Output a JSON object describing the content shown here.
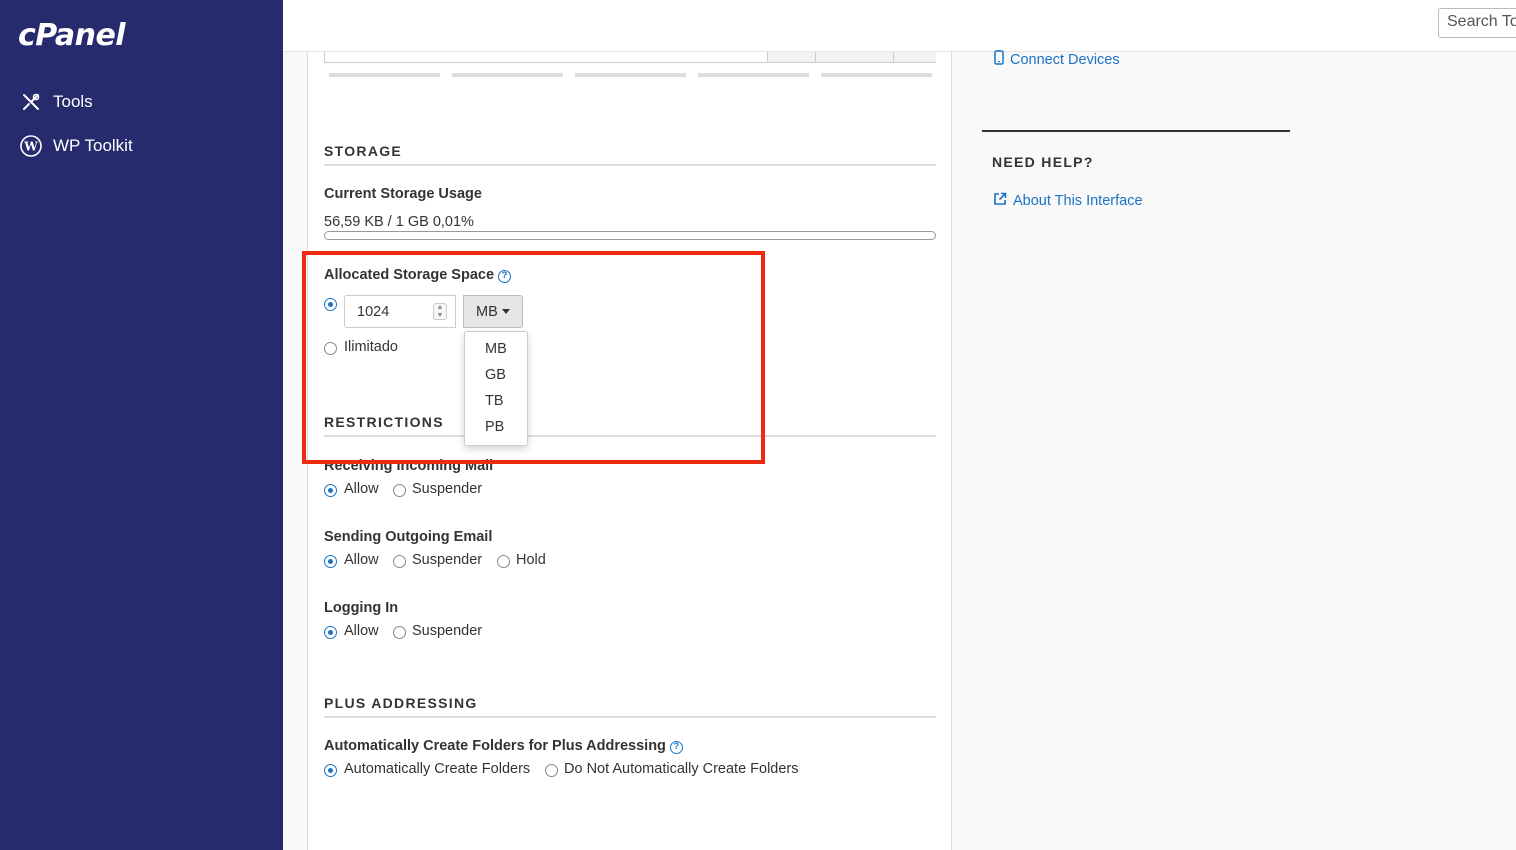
{
  "sidebar": {
    "logo": "cPanel",
    "items": [
      {
        "label": "Tools",
        "icon": "tools-icon"
      },
      {
        "label": "WP Toolkit",
        "icon": "wordpress-icon"
      }
    ]
  },
  "topbar": {
    "search_placeholder": "Search To"
  },
  "storage": {
    "section_title": "STORAGE",
    "usage_label": "Current Storage Usage",
    "usage_text": "56,59 KB / 1 GB 0,01%",
    "usage_fraction": 0.0001,
    "allocated_label": "Allocated Storage Space",
    "allocated_value": "1024",
    "unit_selected": "MB",
    "unit_options": [
      "MB",
      "GB",
      "TB",
      "PB"
    ],
    "unlimited_label": "Ilimitado"
  },
  "restrictions": {
    "section_title": "RESTRICTIONS",
    "incoming": {
      "label": "Receiving Incoming Mail",
      "options": [
        "Allow",
        "Suspender"
      ]
    },
    "outgoing": {
      "label": "Sending Outgoing Email",
      "options": [
        "Allow",
        "Suspender",
        "Hold"
      ]
    },
    "login": {
      "label": "Logging In",
      "options": [
        "Allow",
        "Suspender"
      ]
    }
  },
  "plus_addressing": {
    "section_title": "PLUS ADDRESSING",
    "label": "Automatically Create Folders for Plus Addressing",
    "options": [
      "Automatically Create Folders",
      "Do Not Automatically Create Folders"
    ]
  },
  "right": {
    "connect_devices": "Connect Devices",
    "need_help": "NEED HELP?",
    "about_interface": "About This Interface"
  },
  "colors": {
    "sidebar_bg": "#262b6e",
    "accent": "#1a73c8",
    "highlight": "#ee2a10"
  }
}
